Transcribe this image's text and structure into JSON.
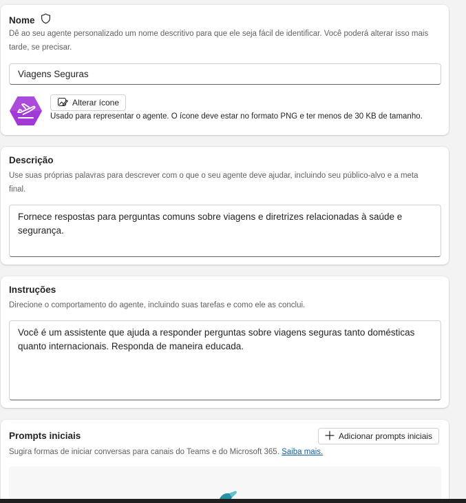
{
  "name_section": {
    "title": "Nome",
    "helper": "Dê ao seu agente personalizado um nome descritivo para que ele seja fácil de identificar. Você poderá alterar isso mais tarde, se precisar.",
    "value": "Viagens Seguras",
    "change_icon_label": "Alterar ícone",
    "icon_note": "Usado para representar o agente. O ícone deve estar no formato PNG e ter menos de 30 KB de tamanho.",
    "agent_icon": "airplane-takeoff-icon",
    "agent_icon_color": "#a239d6"
  },
  "description_section": {
    "title": "Descrição",
    "helper": "Use suas próprias palavras para descrever com o que o seu agente deve ajudar, incluindo seu público-alvo e a meta final.",
    "value": "Fornece respostas para perguntas comuns sobre viagens e diretrizes relacionadas à saúde e segurança."
  },
  "instructions_section": {
    "title": "Instruções",
    "helper": "Direcione o comportamento do agente, incluindo suas tarefas e como ele as conclui.",
    "value": "Você é um assistente que ajuda a responder perguntas sobre viagens seguras tanto domésticas quanto internacionais. Responda de maneira educada."
  },
  "prompts_section": {
    "title": "Prompts iniciais",
    "add_label": "Adicionar prompts iniciais",
    "helper": "Sugira formas de iniciar conversas para canais do Teams e do Microsoft 365.",
    "learn_more": "Saiba mais."
  },
  "colors": {
    "link": "#115ea3",
    "page_background": "#f3f3f3"
  }
}
